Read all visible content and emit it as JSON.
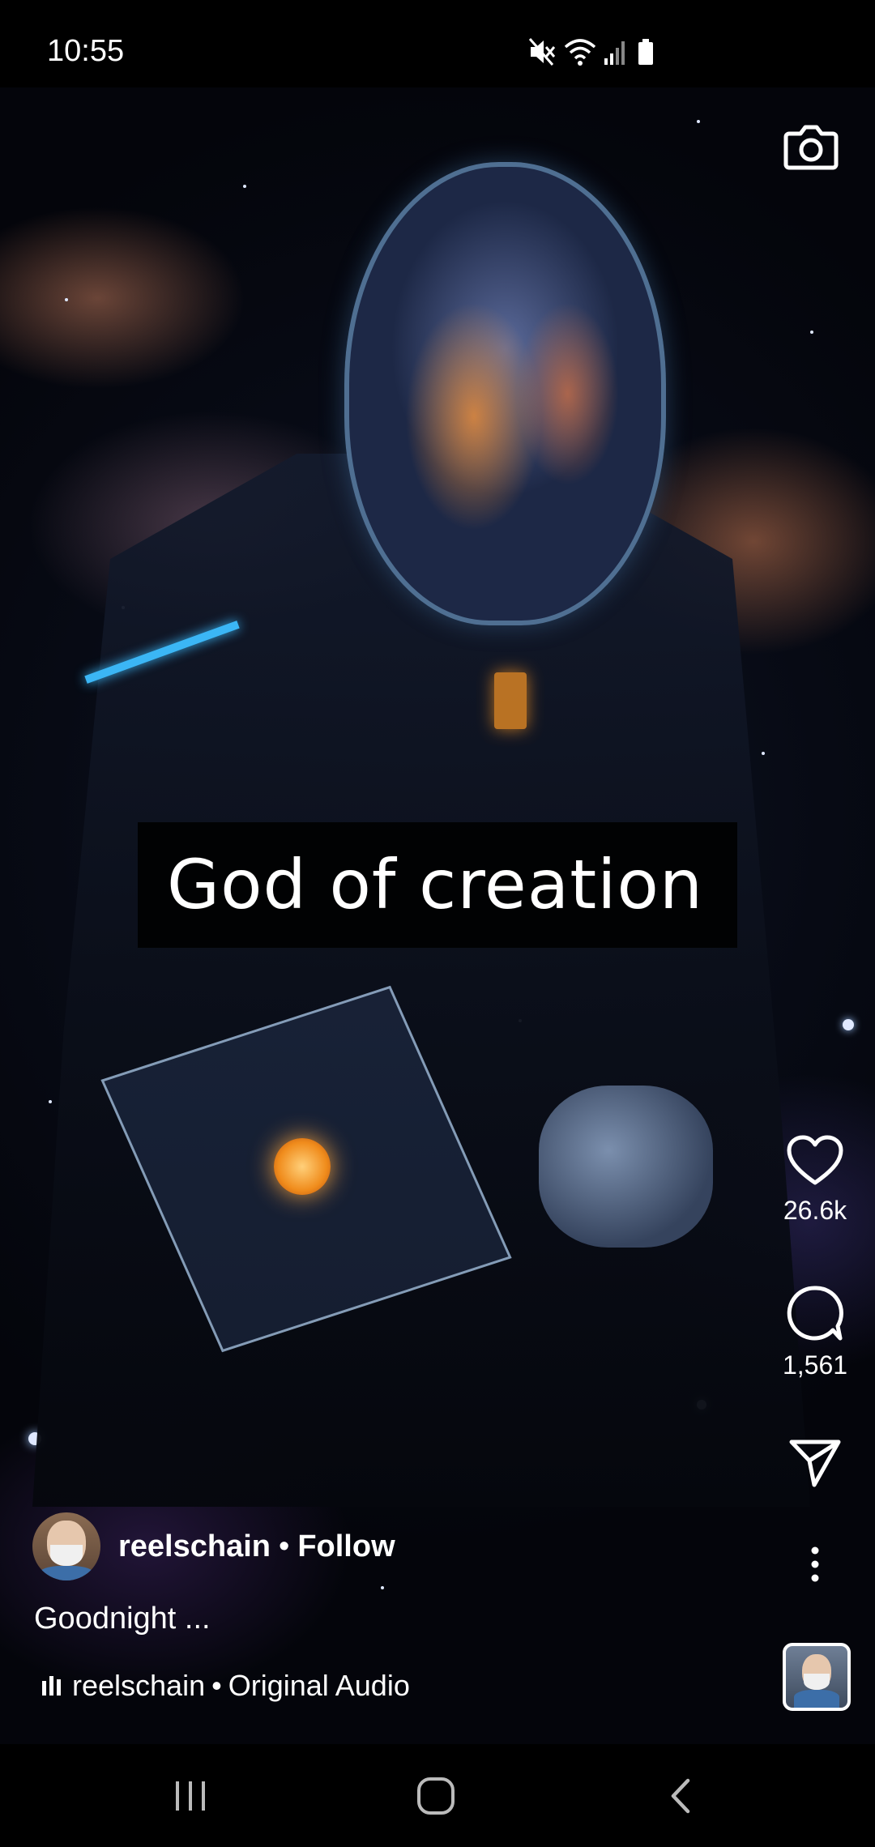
{
  "status_bar": {
    "time": "10:55",
    "icons": [
      "mute-icon",
      "wifi-icon",
      "signal-icon",
      "battery-icon"
    ]
  },
  "video": {
    "overlay_caption": "God of creation"
  },
  "camera": {
    "icon": "camera-icon"
  },
  "actions": {
    "like": {
      "icon": "heart-icon",
      "count": "26.6k"
    },
    "comment": {
      "icon": "comment-icon",
      "count": "1,561"
    },
    "share": {
      "icon": "send-icon"
    },
    "more": {
      "icon": "more-vertical-icon"
    }
  },
  "post": {
    "author": "reelschain",
    "separator": "•",
    "follow_label": "Follow",
    "description": "Goodnight ...",
    "audio_author": "reelschain",
    "audio_separator": "•",
    "audio_title": "Original Audio"
  },
  "nav_bar": {
    "buttons": [
      "recent-apps-icon",
      "home-icon",
      "back-icon"
    ]
  },
  "colors": {
    "background": "#000000",
    "text": "#ffffff",
    "accent_glow": "#3bb6f5"
  }
}
